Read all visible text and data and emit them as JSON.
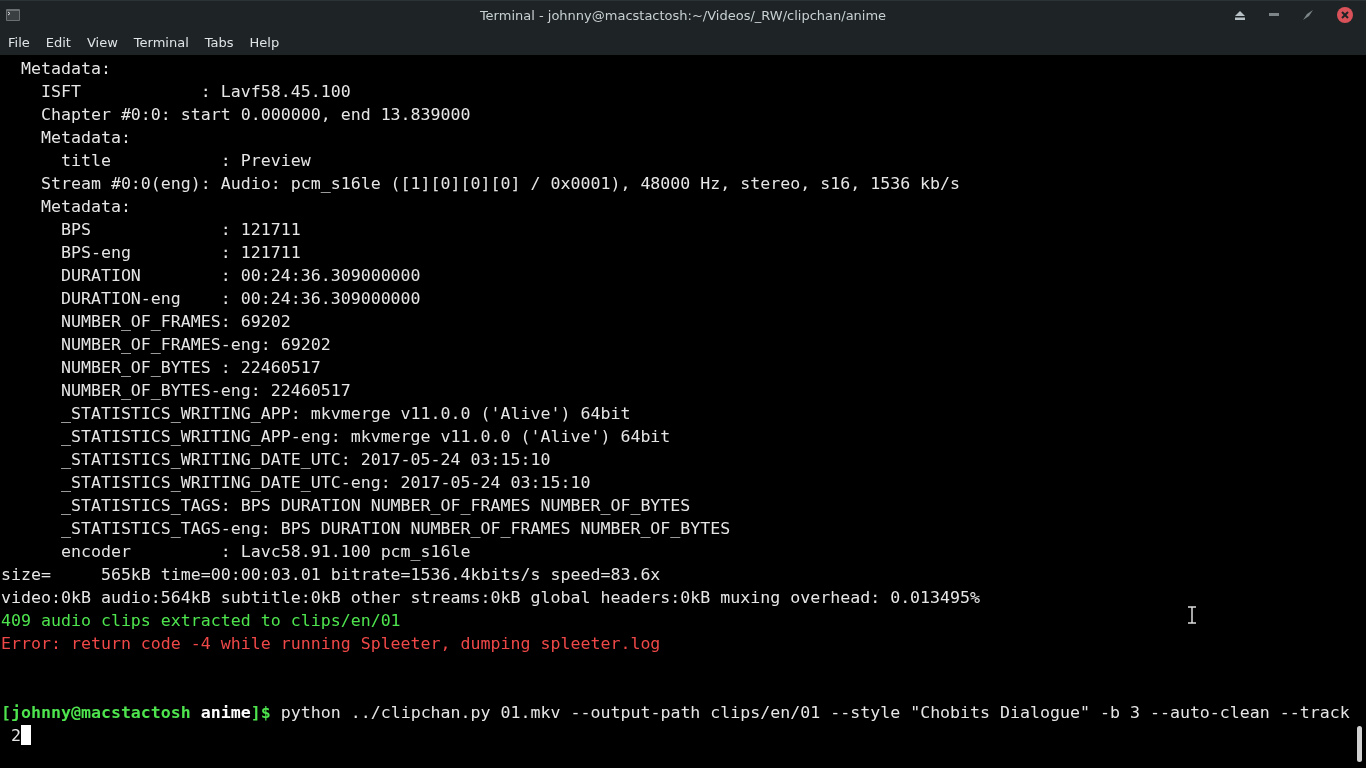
{
  "window": {
    "title": "Terminal - johnny@macstactosh:~/Videos/_RW/clipchan/anime"
  },
  "menu": [
    "File",
    "Edit",
    "View",
    "Terminal",
    "Tabs",
    "Help"
  ],
  "lines": [
    {
      "kind": "output",
      "text": "  Metadata:"
    },
    {
      "kind": "output",
      "text": "    ISFT            : Lavf58.45.100"
    },
    {
      "kind": "output",
      "text": "    Chapter #0:0: start 0.000000, end 13.839000"
    },
    {
      "kind": "output",
      "text": "    Metadata:"
    },
    {
      "kind": "output",
      "text": "      title           : Preview"
    },
    {
      "kind": "output",
      "text": "    Stream #0:0(eng): Audio: pcm_s16le ([1][0][0][0] / 0x0001), 48000 Hz, stereo, s16, 1536 kb/s"
    },
    {
      "kind": "output",
      "text": "    Metadata:"
    },
    {
      "kind": "output",
      "text": "      BPS             : 121711"
    },
    {
      "kind": "output",
      "text": "      BPS-eng         : 121711"
    },
    {
      "kind": "output",
      "text": "      DURATION        : 00:24:36.309000000"
    },
    {
      "kind": "output",
      "text": "      DURATION-eng    : 00:24:36.309000000"
    },
    {
      "kind": "output",
      "text": "      NUMBER_OF_FRAMES: 69202"
    },
    {
      "kind": "output",
      "text": "      NUMBER_OF_FRAMES-eng: 69202"
    },
    {
      "kind": "output",
      "text": "      NUMBER_OF_BYTES : 22460517"
    },
    {
      "kind": "output",
      "text": "      NUMBER_OF_BYTES-eng: 22460517"
    },
    {
      "kind": "output",
      "text": "      _STATISTICS_WRITING_APP: mkvmerge v11.0.0 ('Alive') 64bit"
    },
    {
      "kind": "output",
      "text": "      _STATISTICS_WRITING_APP-eng: mkvmerge v11.0.0 ('Alive') 64bit"
    },
    {
      "kind": "output",
      "text": "      _STATISTICS_WRITING_DATE_UTC: 2017-05-24 03:15:10"
    },
    {
      "kind": "output",
      "text": "      _STATISTICS_WRITING_DATE_UTC-eng: 2017-05-24 03:15:10"
    },
    {
      "kind": "output",
      "text": "      _STATISTICS_TAGS: BPS DURATION NUMBER_OF_FRAMES NUMBER_OF_BYTES"
    },
    {
      "kind": "output",
      "text": "      _STATISTICS_TAGS-eng: BPS DURATION NUMBER_OF_FRAMES NUMBER_OF_BYTES"
    },
    {
      "kind": "output",
      "text": "      encoder         : Lavc58.91.100 pcm_s16le"
    },
    {
      "kind": "output",
      "text": "size=     565kB time=00:00:03.01 bitrate=1536.4kbits/s speed=83.6x"
    },
    {
      "kind": "output",
      "text": "video:0kB audio:564kB subtitle:0kB other streams:0kB global headers:0kB muxing overhead: 0.013495%"
    },
    {
      "kind": "success",
      "text": "409 audio clips extracted to clips/en/01"
    },
    {
      "kind": "error",
      "text": "Error: return code -4 while running Spleeter, dumping spleeter.log"
    },
    {
      "kind": "blank"
    },
    {
      "kind": "blank"
    }
  ],
  "prompt": {
    "user_host": "[johnny@macstactosh",
    "dir": "anime",
    "end": "]$",
    "command": "python ../clipchan.py 01.mkv --output-path clips/en/01 --style \"Chobits Dialogue\" -b 3 --auto-clean --track",
    "wrapped": " 2"
  }
}
